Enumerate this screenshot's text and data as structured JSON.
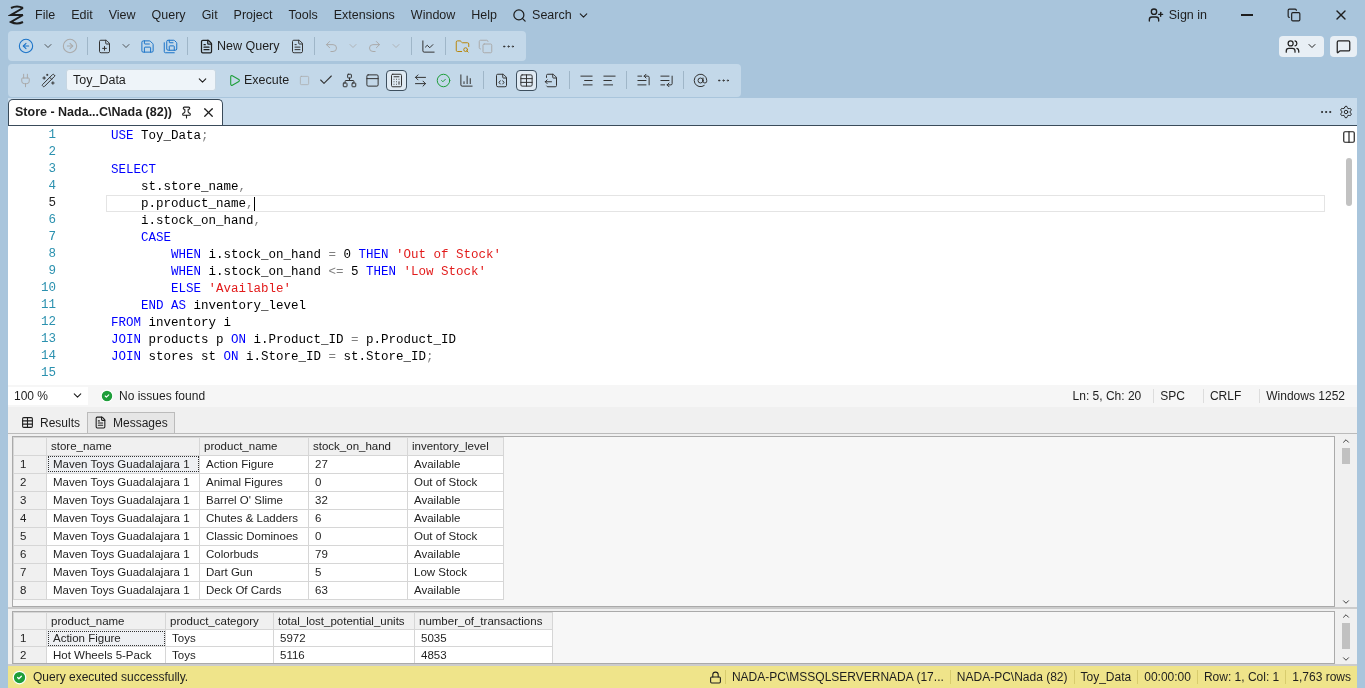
{
  "menu": [
    "File",
    "Edit",
    "View",
    "Query",
    "Git",
    "Project",
    "Tools",
    "Extensions",
    "Window",
    "Help"
  ],
  "search": {
    "label": "Search"
  },
  "account": {
    "label": "Sign in"
  },
  "standard_toolbar": {
    "new_query": "New Query"
  },
  "query_toolbar": {
    "database": "Toy_Data",
    "execute": "Execute",
    "intellisense_enabled": true,
    "results_modes": [
      {
        "selected": false
      },
      {
        "selected": true
      },
      {
        "selected": false
      }
    ]
  },
  "document_tab": {
    "title": "Store - Nada...C\\Nada (82))",
    "selected": true
  },
  "editor": {
    "lines": [
      {
        "number": "1",
        "current": false,
        "tokens": [
          {
            "kind": "kw",
            "text": "USE"
          },
          {
            "kind": "id",
            "text": " Toy_Data"
          },
          {
            "kind": "op",
            "text": ";"
          }
        ]
      },
      {
        "number": "2",
        "current": false
      },
      {
        "number": "3",
        "current": false,
        "tokens": [
          {
            "kind": "kw",
            "text": "SELECT"
          }
        ]
      },
      {
        "number": "4",
        "current": false,
        "tokens": [
          {
            "kind": "id",
            "text": "    st.store_name"
          },
          {
            "kind": "op",
            "text": ","
          }
        ]
      },
      {
        "number": "5",
        "current": true,
        "tokens": [
          {
            "kind": "id",
            "text": "    p.product_name"
          },
          {
            "kind": "op",
            "text": ","
          }
        ]
      },
      {
        "number": "6",
        "current": false,
        "tokens": [
          {
            "kind": "id",
            "text": "    i.stock_on_hand"
          },
          {
            "kind": "op",
            "text": ","
          }
        ]
      },
      {
        "number": "7",
        "current": false,
        "tokens": [
          {
            "kind": "kw",
            "text": "    CASE"
          }
        ]
      },
      {
        "number": "8",
        "current": false,
        "tokens": [
          {
            "kind": "kw",
            "text": "        WHEN"
          },
          {
            "kind": "id",
            "text": " i.stock_on_hand "
          },
          {
            "kind": "op",
            "text": "="
          },
          {
            "kind": "id",
            "text": " 0 "
          },
          {
            "kind": "kw",
            "text": "THEN"
          },
          {
            "kind": "str",
            "text": " 'Out of Stock'"
          }
        ]
      },
      {
        "number": "9",
        "current": false,
        "tokens": [
          {
            "kind": "kw",
            "text": "        WHEN"
          },
          {
            "kind": "id",
            "text": " i.stock_on_hand "
          },
          {
            "kind": "op",
            "text": "<="
          },
          {
            "kind": "id",
            "text": " 5 "
          },
          {
            "kind": "kw",
            "text": "THEN"
          },
          {
            "kind": "str",
            "text": " 'Low Stock'"
          }
        ]
      },
      {
        "number": "10",
        "current": false,
        "tokens": [
          {
            "kind": "kw",
            "text": "        ELSE"
          },
          {
            "kind": "str",
            "text": " 'Available'"
          }
        ]
      },
      {
        "number": "11",
        "current": false,
        "tokens": [
          {
            "kind": "kw",
            "text": "    END AS"
          },
          {
            "kind": "id",
            "text": " inventory_level"
          }
        ]
      },
      {
        "number": "12",
        "current": false,
        "tokens": [
          {
            "kind": "kw",
            "text": "FROM"
          },
          {
            "kind": "id",
            "text": " inventory i"
          }
        ]
      },
      {
        "number": "13",
        "current": false,
        "tokens": [
          {
            "kind": "kw",
            "text": "JOIN"
          },
          {
            "kind": "id",
            "text": " products p "
          },
          {
            "kind": "kw",
            "text": "ON"
          },
          {
            "kind": "id",
            "text": " i.Product_ID "
          },
          {
            "kind": "op",
            "text": "="
          },
          {
            "kind": "id",
            "text": " p.Product_ID"
          }
        ]
      },
      {
        "number": "14",
        "current": false,
        "tokens": [
          {
            "kind": "kw",
            "text": "JOIN"
          },
          {
            "kind": "id",
            "text": " stores st "
          },
          {
            "kind": "kw",
            "text": "ON"
          },
          {
            "kind": "id",
            "text": " i.Store_ID "
          },
          {
            "kind": "op",
            "text": "="
          },
          {
            "kind": "id",
            "text": " st.Store_ID"
          },
          {
            "kind": "op",
            "text": ";"
          }
        ]
      },
      {
        "number": "15",
        "current": false
      }
    ]
  },
  "editor_status": {
    "zoom": "100 %",
    "issues": "No issues found",
    "position": "Ln: 5, Ch: 20",
    "indent": "SPC",
    "line_endings": "CRLF",
    "encoding": "Windows 1252"
  },
  "result_tabs": [
    {
      "label": "Results",
      "selected": true
    },
    {
      "label": "Messages",
      "selected": false
    }
  ],
  "result_grids": [
    {
      "columns": [
        "store_name",
        "product_name",
        "stock_on_hand",
        "inventory_level"
      ],
      "rows": [
        {
          "number": "1",
          "focused": true,
          "cells": [
            "Maven Toys Guadalajara 1",
            "Action Figure",
            "27",
            "Available"
          ]
        },
        {
          "number": "2",
          "focused": false,
          "cells": [
            "Maven Toys Guadalajara 1",
            "Animal Figures",
            "0",
            "Out of Stock"
          ]
        },
        {
          "number": "3",
          "focused": false,
          "cells": [
            "Maven Toys Guadalajara 1",
            "Barrel O' Slime",
            "32",
            "Available"
          ]
        },
        {
          "number": "4",
          "focused": false,
          "cells": [
            "Maven Toys Guadalajara 1",
            "Chutes & Ladders",
            "6",
            "Available"
          ]
        },
        {
          "number": "5",
          "focused": false,
          "cells": [
            "Maven Toys Guadalajara 1",
            "Classic Dominoes",
            "0",
            "Out of Stock"
          ]
        },
        {
          "number": "6",
          "focused": false,
          "cells": [
            "Maven Toys Guadalajara 1",
            "Colorbuds",
            "79",
            "Available"
          ]
        },
        {
          "number": "7",
          "focused": false,
          "cells": [
            "Maven Toys Guadalajara 1",
            "Dart Gun",
            "5",
            "Low Stock"
          ]
        },
        {
          "number": "8",
          "focused": false,
          "cells": [
            "Maven Toys Guadalajara 1",
            "Deck Of Cards",
            "63",
            "Available"
          ]
        }
      ]
    },
    {
      "columns": [
        "product_name",
        "product_category",
        "total_lost_potential_units",
        "number_of_transactions"
      ],
      "rows": [
        {
          "number": "1",
          "focused": true,
          "cells": [
            "Action Figure",
            "Toys",
            "5972",
            "5035"
          ]
        },
        {
          "number": "2",
          "focused": false,
          "cells": [
            "Hot Wheels 5-Pack",
            "Toys",
            "5116",
            "4853"
          ]
        }
      ]
    }
  ],
  "status_bar": {
    "message": "Query executed successfully.",
    "server": "NADA-PC\\MSSQLSERVERNADA (17...",
    "user": "NADA-PC\\Nada (82)",
    "database": "Toy_Data",
    "elapsed": "00:00:00",
    "position": "Row: 1, Col: 1",
    "rows": "1,763 rows"
  }
}
